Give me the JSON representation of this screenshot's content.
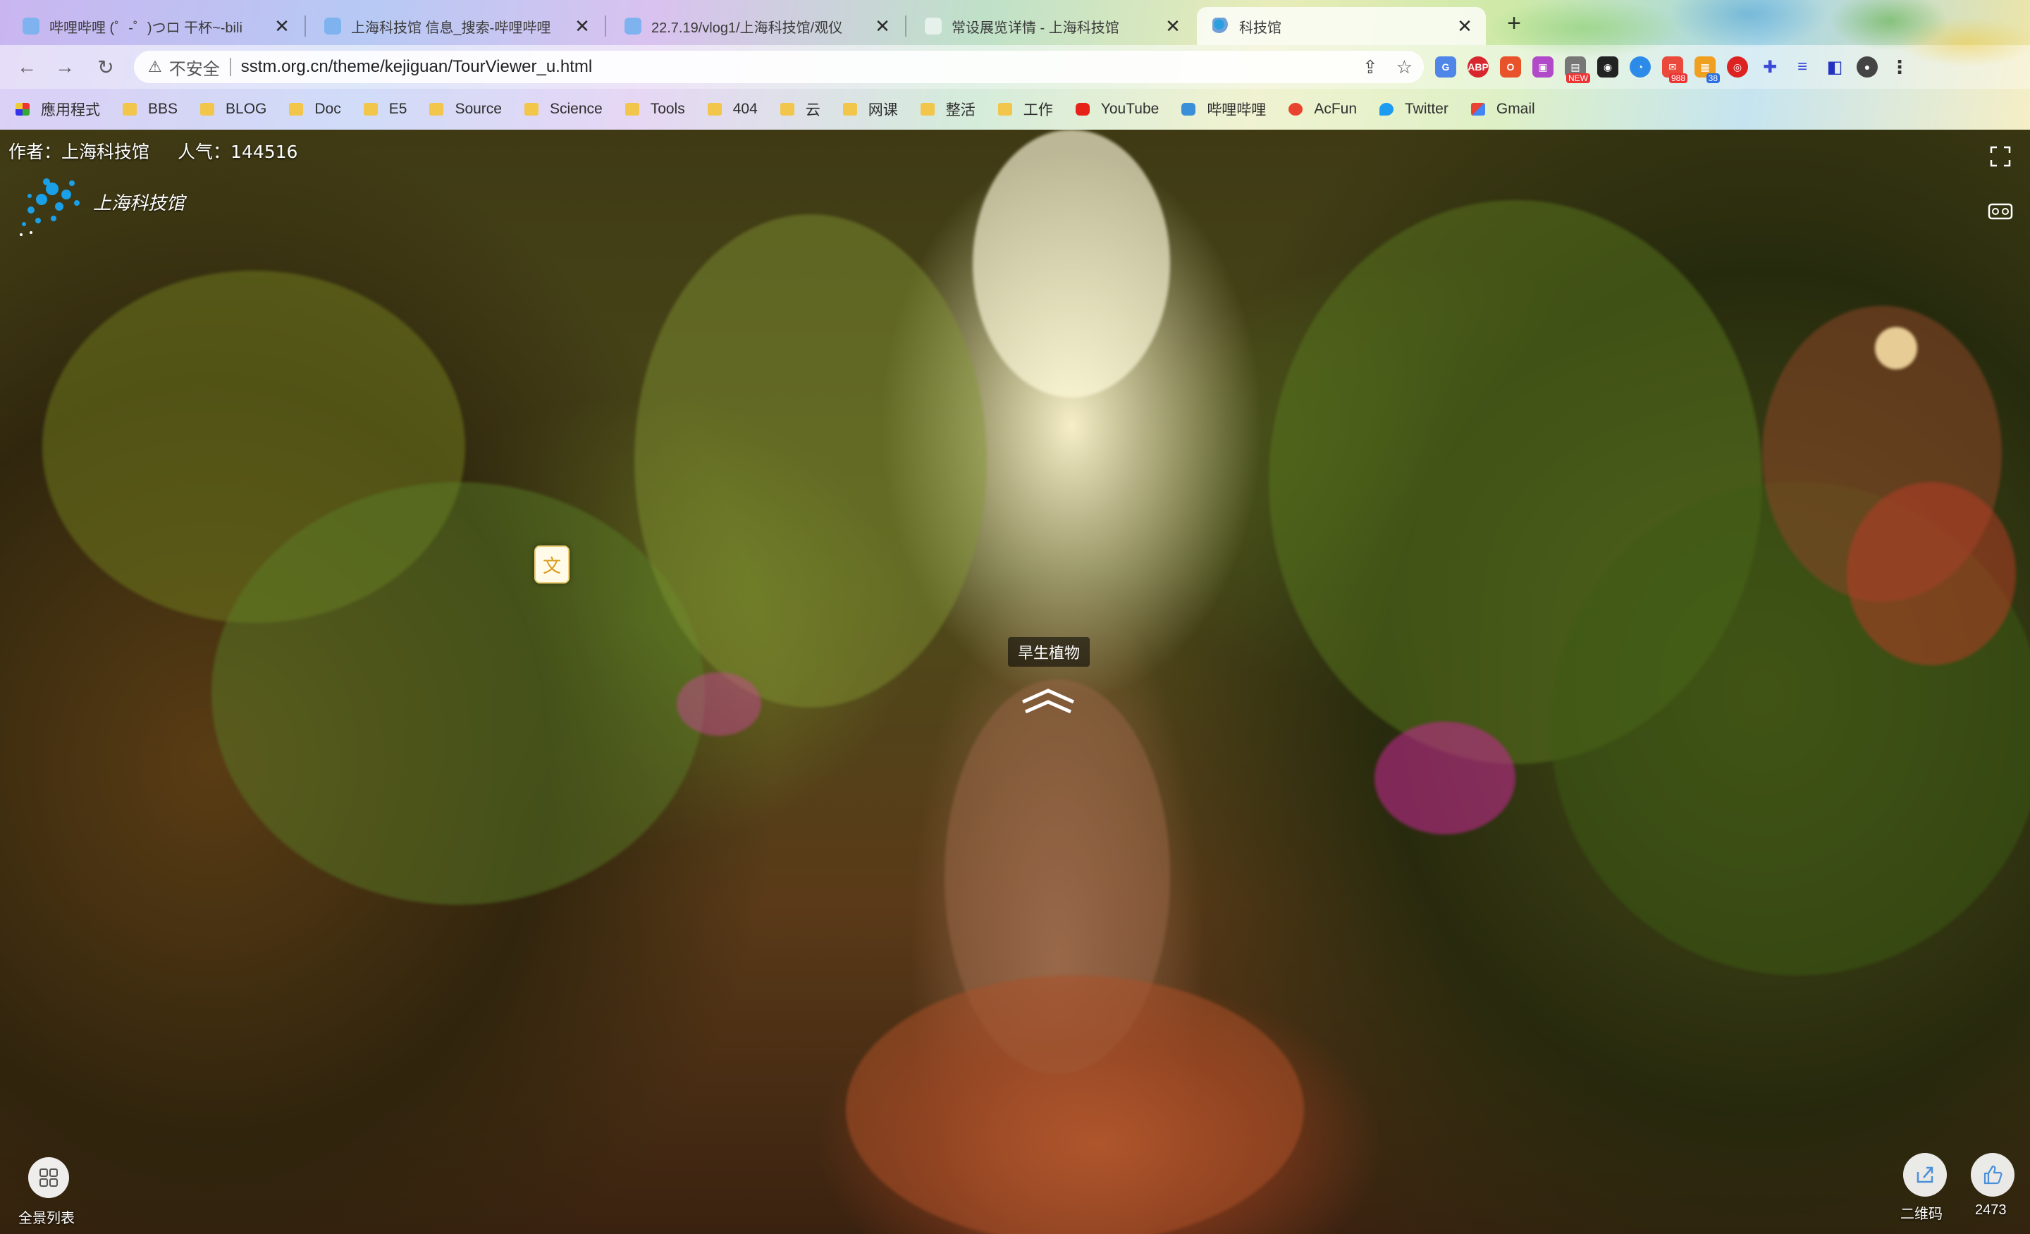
{
  "browser": {
    "tabs": [
      {
        "title": "哔哩哔哩 (゜-゜)つロ 干杯~-bili",
        "icon_color": "#7fb3f0",
        "active": false
      },
      {
        "title": "上海科技馆 信息_搜索-哔哩哔哩",
        "icon_color": "#7fb3f0",
        "active": false
      },
      {
        "title": "22.7.19/vlog1/上海科技馆/观仪",
        "icon_color": "#7fb3f0",
        "active": false
      },
      {
        "title": "常设展览详情 - 上海科技馆",
        "icon_color": "#ffffff",
        "active": false
      },
      {
        "title": "科技馆",
        "icon_color": "#6fa0d8",
        "active": true
      }
    ],
    "tab_close_glyph": "✕",
    "new_tab_glyph": "+",
    "security_label": "不安全",
    "url": "sstm.org.cn/theme/kejiguan/TourViewer_u.html",
    "extension_badges": {
      "mail": "988",
      "count": "38",
      "new": "NEW"
    },
    "bookmarks": [
      {
        "label": "應用程式",
        "icon": "apps-grid-icon"
      },
      {
        "label": "BBS",
        "icon": "folder-icon"
      },
      {
        "label": "BLOG",
        "icon": "folder-icon"
      },
      {
        "label": "Doc",
        "icon": "folder-icon"
      },
      {
        "label": "E5",
        "icon": "folder-icon"
      },
      {
        "label": "Source",
        "icon": "folder-icon"
      },
      {
        "label": "Science",
        "icon": "folder-icon"
      },
      {
        "label": "Tools",
        "icon": "folder-icon"
      },
      {
        "label": "404",
        "icon": "folder-icon"
      },
      {
        "label": "云",
        "icon": "folder-icon"
      },
      {
        "label": "网课",
        "icon": "folder-icon"
      },
      {
        "label": "整活",
        "icon": "folder-icon"
      },
      {
        "label": "工作",
        "icon": "folder-icon"
      },
      {
        "label": "YouTube",
        "icon": "youtube-icon"
      },
      {
        "label": "哔哩哔哩",
        "icon": "bilibili-icon"
      },
      {
        "label": "AcFun",
        "icon": "acfun-icon"
      },
      {
        "label": "Twitter",
        "icon": "twitter-icon"
      },
      {
        "label": "Gmail",
        "icon": "gmail-icon"
      }
    ]
  },
  "viewer": {
    "author_label": "作者：上海科技馆",
    "popularity_label": "人气：144516",
    "logo_text": "上海科技馆",
    "text_hotspot_glyph": "文",
    "scene_tag": "旱生植物",
    "pano_list_label": "全景列表",
    "qr_label": "二维码",
    "like_count": "2473"
  }
}
